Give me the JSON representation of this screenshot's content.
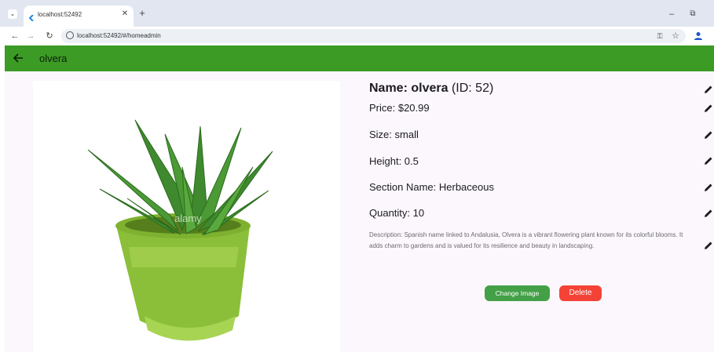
{
  "browser": {
    "tab_title": "localhost:52492",
    "url": "localhost:52492/#/homeadmin"
  },
  "appbar": {
    "title": "olvera",
    "color": "#3b9b24"
  },
  "product": {
    "name_label": "Name:",
    "name": "olvera",
    "id_text": "(ID: 52)",
    "price": "Price: $20.99",
    "size": "Size: small",
    "height": "Height: 0.5",
    "section": "Section Name: Herbaceous",
    "quantity": "Quantity: 10",
    "description": "Description: Spanish name linked to Andalusia, Olvera is a vibrant flowering plant known for its colorful blooms. It adds charm to gardens and is valued for its resilience and beauty in landscaping.",
    "image_watermark": "alamy"
  },
  "actions": {
    "change_image": "Change Image",
    "delete": "Delete",
    "change_color": "#43a047",
    "delete_color": "#f44336"
  },
  "icons": [
    "dropdown-icon",
    "favicon-icon",
    "close-icon",
    "new-tab-icon",
    "minimize-icon",
    "restore-icon",
    "back-icon",
    "forward-icon",
    "reload-icon",
    "site-info-icon",
    "password-key-icon",
    "bookmark-star-icon",
    "profile-icon",
    "edit-icon"
  ]
}
